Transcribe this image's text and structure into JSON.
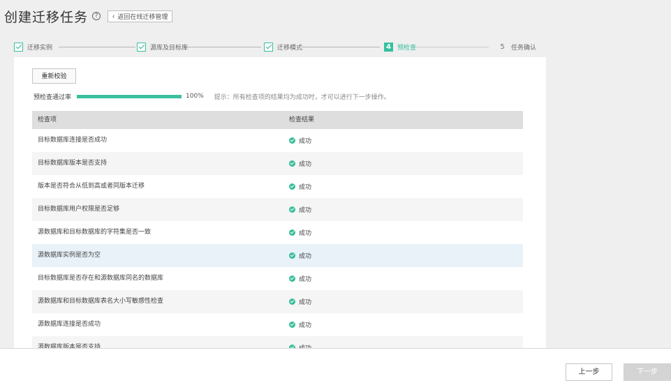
{
  "header": {
    "title": "创建迁移任务",
    "back_label": "返回在线迁移管理",
    "help_icon": "question-circle-icon"
  },
  "steps": [
    {
      "label": "迁移实例",
      "state": "done"
    },
    {
      "label": "源库及目标库",
      "state": "done"
    },
    {
      "label": "迁移模式",
      "state": "done"
    },
    {
      "label": "预检查",
      "number": "4",
      "state": "active"
    },
    {
      "label": "任务确认",
      "number": "5",
      "state": "pending"
    }
  ],
  "precheck": {
    "recheck_label": "重新校验",
    "pass_rate_label": "预检查通过率",
    "progress": 1.0,
    "percent_text": "100%",
    "hint": "提示：所有检查项的结果均为成功时，才可以进行下一步操作。"
  },
  "table": {
    "headers": [
      "检查项",
      "检查结果"
    ],
    "rows": [
      {
        "item": "目标数据库连接是否成功",
        "result": "成功"
      },
      {
        "item": "目标数据库版本是否支持",
        "result": "成功"
      },
      {
        "item": "版本是否符合从低到高或者同版本迁移",
        "result": "成功"
      },
      {
        "item": "目标数据库用户权限是否足够",
        "result": "成功"
      },
      {
        "item": "源数据库和目标数据库的字符集是否一致",
        "result": "成功"
      },
      {
        "item": "源数据库实例是否为空",
        "result": "成功"
      },
      {
        "item": "目标数据库是否存在和源数据库同名的数据库",
        "result": "成功"
      },
      {
        "item": "源数据库和目标数据库表名大小写敏感性检查",
        "result": "成功"
      },
      {
        "item": "源数据库连接是否成功",
        "result": "成功"
      },
      {
        "item": "源数据库版本是否支持",
        "result": "成功"
      }
    ]
  },
  "footer": {
    "prev_label": "上一步",
    "next_label": "下一步"
  },
  "colors": {
    "accent": "#36c09f",
    "success": "#37bd99",
    "disabled_button": "#d4d4d4"
  }
}
